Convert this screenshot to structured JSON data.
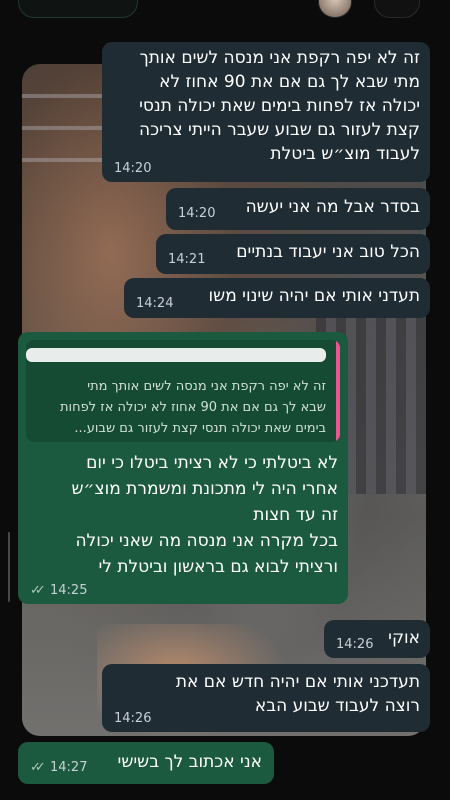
{
  "chat": {
    "messages": [
      {
        "lines": [
          "זה לא יפה רקפת אני מנסה לשים אותך",
          "מתי שבא לך גם אם את 90 אחוז לא",
          "יכולה אז לפחות בימים שאת יכולה תנסי",
          "קצת לעזור גם שבוע שעבר הייתי צריכה",
          "לעבוד מוצ״ש ביטלת"
        ],
        "time": "14:20"
      },
      {
        "lines": [
          "בסדר אבל מה אני יעשה"
        ],
        "time": "14:20"
      },
      {
        "lines": [
          "הכל טוב אני יעבוד בנתיים"
        ],
        "time": "14:21"
      },
      {
        "lines": [
          "תעדני אותי אם יהיה שינוי משו"
        ],
        "time": "14:24"
      },
      {
        "quoted": {
          "lines": [
            "זה לא יפה רקפת אני מנסה לשים אותך מתי",
            "שבא לך גם אם את 90 אחוז לא יכולה אז לפחות",
            "בימים שאת יכולה תנסי קצת לעזור גם שבוע..."
          ]
        },
        "lines": [
          "לא ביטלתי כי לא רציתי ביטלו כי יום",
          "אחרי היה לי מתכונת ומשמרת מוצ״ש",
          "זה עד חצות",
          "בכל מקרה אני מנסה מה שאני יכולה",
          "ורציתי לבוא גם בראשון וביטלת לי"
        ],
        "time": "14:25",
        "ticks": "✓✓"
      },
      {
        "lines": [
          "אוקי"
        ],
        "time": "14:26"
      },
      {
        "lines": [
          "תעדכני אותי אם יהיה חדש אם את",
          "רוצה לעבוד שבוע הבא"
        ],
        "time": "14:26"
      },
      {
        "lines": [
          "אני אכתוב לך בשישי"
        ],
        "time": "14:27",
        "ticks": "✓✓"
      }
    ]
  },
  "colors": {
    "incoming_bubble": "#1f2c34",
    "outgoing_bubble": "#1c5a3f",
    "quote_accent": "#e45a90",
    "read_ticks": "#a9c7b9"
  },
  "icons": {
    "back": "chevron-left-icon",
    "avatar": "contact-avatar",
    "ticks": "double-check-icon"
  }
}
